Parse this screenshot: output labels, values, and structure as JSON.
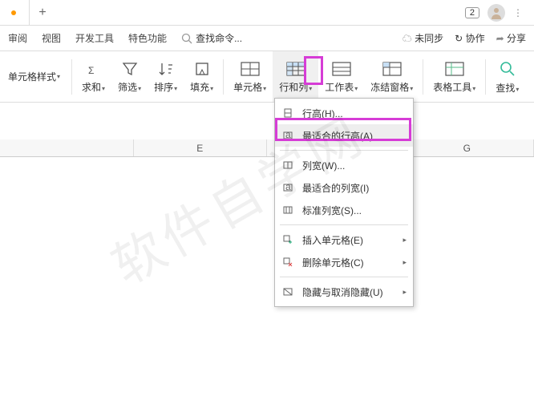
{
  "tabbar": {
    "page_badge": "2",
    "newtab": "+"
  },
  "menu": {
    "items": [
      "审阅",
      "视图",
      "开发工具",
      "特色功能"
    ],
    "search_ph": "查找命令...",
    "right": {
      "unsync": "未同步",
      "coop": "协作",
      "share": "分享"
    }
  },
  "ribbon": {
    "cell_style": "单元格样式",
    "sum": "求和",
    "filter": "筛选",
    "sort": "排序",
    "fill": "填充",
    "cell": "单元格",
    "rowcol": "行和列",
    "worksheet": "工作表",
    "freeze": "冻结窗格",
    "tabletools": "表格工具",
    "find": "查找"
  },
  "cols": [
    "",
    "E",
    "",
    "G"
  ],
  "dropdown": {
    "rowh": "行高(H)...",
    "bestrowh": "最适合的行高(A)",
    "colw": "列宽(W)...",
    "bestcolw": "最适合的列宽(I)",
    "stdcolw": "标准列宽(S)...",
    "insert": "插入单元格(E)",
    "delete": "删除单元格(C)",
    "hide": "隐藏与取消隐藏(U)"
  },
  "watermark": "软件自学网"
}
